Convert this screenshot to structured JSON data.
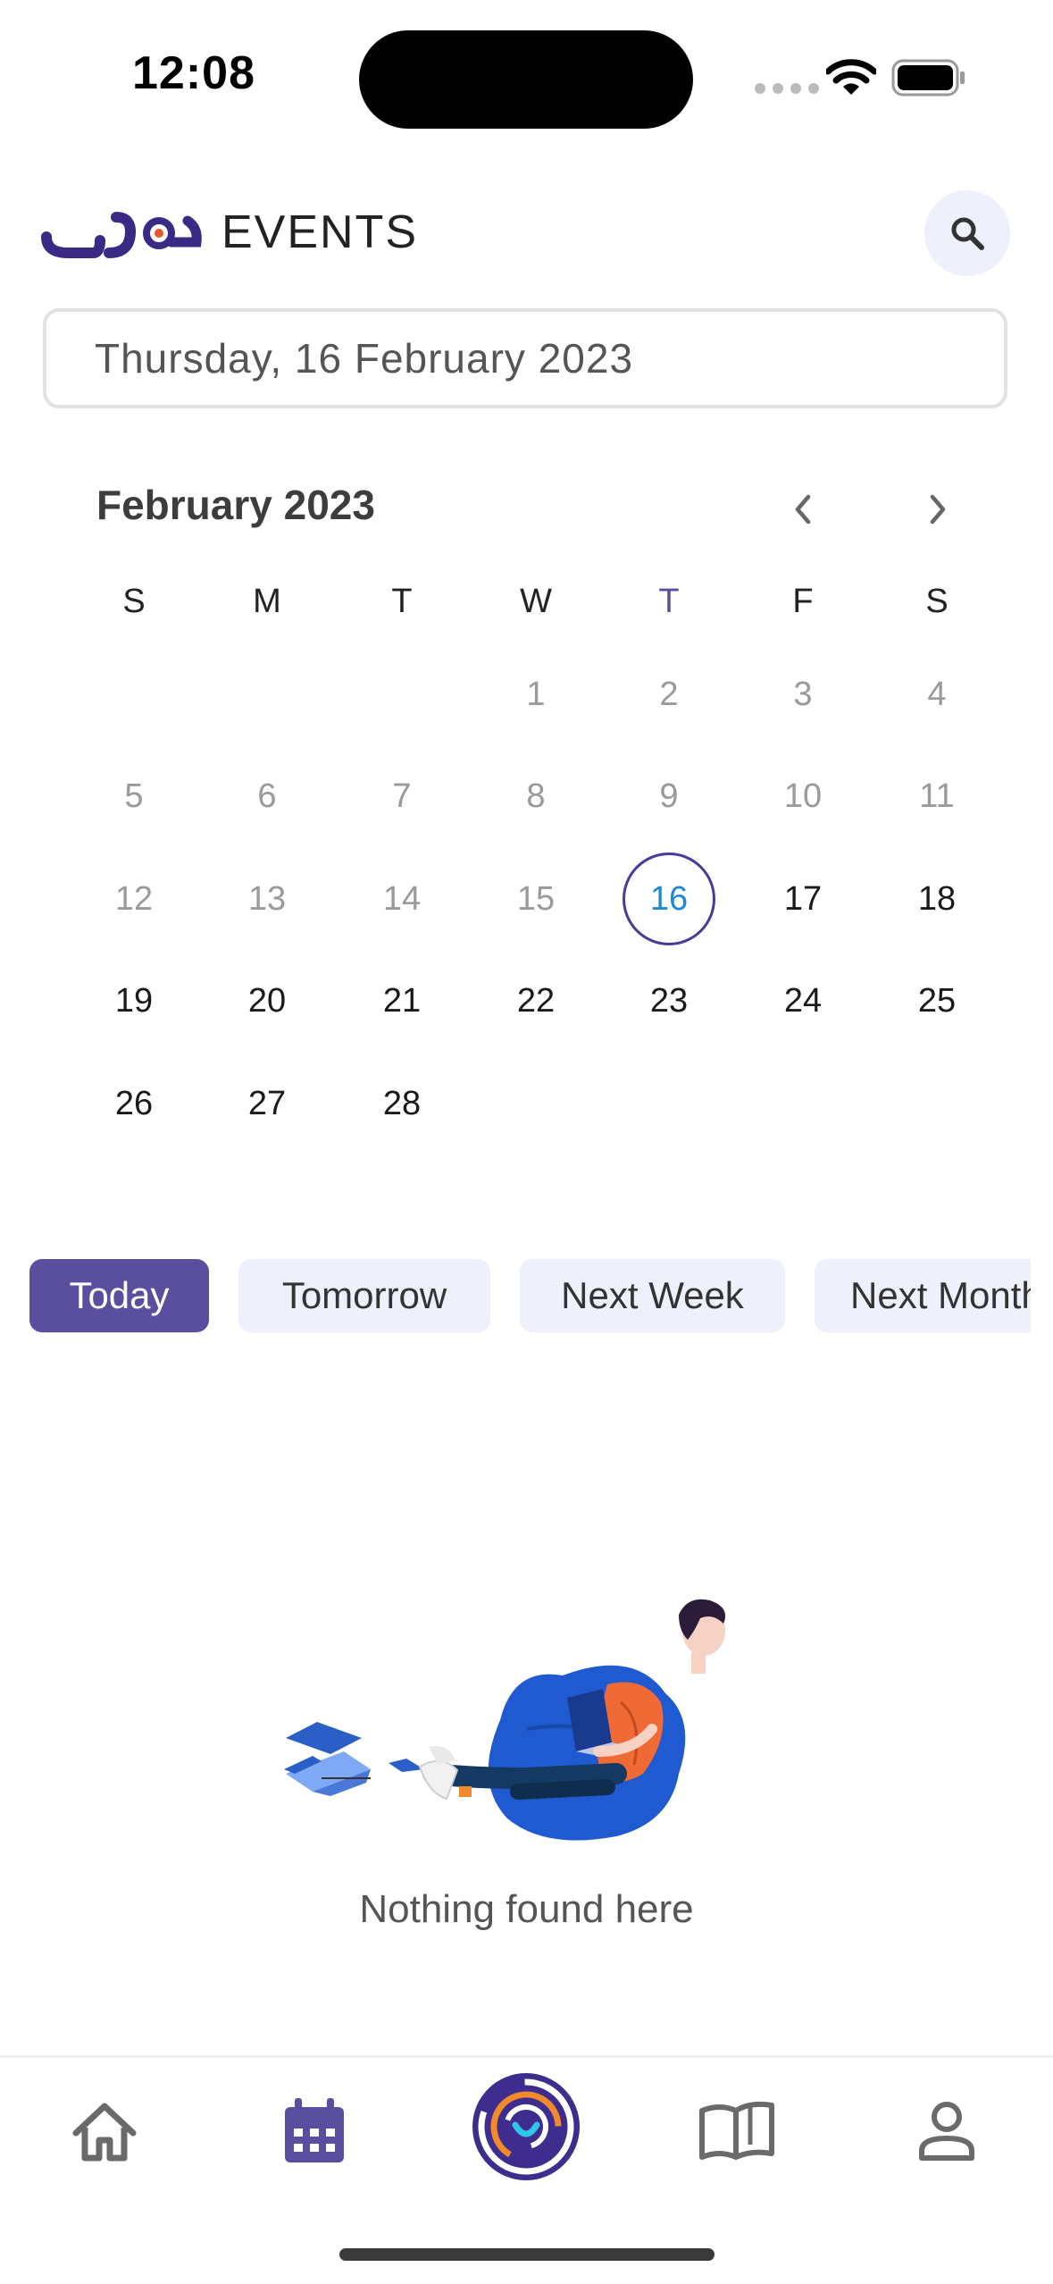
{
  "status_bar": {
    "time": "12:08"
  },
  "header": {
    "brand_name": "دروب",
    "title": "EVENTS"
  },
  "date_field": {
    "value": "Thursday, 16 February 2023"
  },
  "calendar": {
    "month_label": "February 2023",
    "weekdays": [
      "S",
      "M",
      "T",
      "W",
      "T",
      "F",
      "S"
    ],
    "weeks": [
      [
        "",
        "",
        "",
        "1",
        "2",
        "3",
        "4"
      ],
      [
        "5",
        "6",
        "7",
        "8",
        "9",
        "10",
        "11"
      ],
      [
        "12",
        "13",
        "14",
        "15",
        "16",
        "17",
        "18"
      ],
      [
        "19",
        "20",
        "21",
        "22",
        "23",
        "24",
        "25"
      ],
      [
        "26",
        "27",
        "28",
        "",
        "",
        "",
        ""
      ]
    ],
    "selected_day": "16"
  },
  "filters": [
    "Today",
    "Tomorrow",
    "Next Week",
    "Next Month"
  ],
  "active_filter": "Today",
  "empty_state": {
    "message": "Nothing found here"
  },
  "bottom_nav": [
    "home-icon",
    "calendar-icon",
    "app-logo",
    "book-icon",
    "profile-icon"
  ],
  "colors": {
    "accent": "#5a4f9e",
    "selected_day": "#1e88d8",
    "chip_bg": "#eef1fb"
  }
}
